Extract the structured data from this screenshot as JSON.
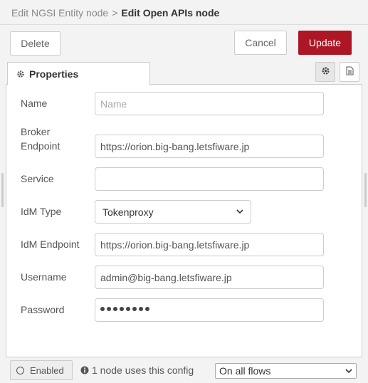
{
  "header": {
    "prev_crumb": "Edit NGSI Entity node",
    "separator": ">",
    "current_crumb": "Edit Open APIs node"
  },
  "toolbar": {
    "delete_label": "Delete",
    "cancel_label": "Cancel",
    "update_label": "Update"
  },
  "tabs": {
    "properties_label": "Properties",
    "settings_icon": "gear-icon",
    "info_icon": "document-icon"
  },
  "form": {
    "name": {
      "label": "Name",
      "value": "",
      "placeholder": "Name"
    },
    "broker_endpoint": {
      "label_line1": "Broker",
      "label_line2": "Endpoint",
      "value": "https://orion.big-bang.letsfiware.jp"
    },
    "service": {
      "label": "Service",
      "value": ""
    },
    "idm_type": {
      "label": "IdM Type",
      "value": "Tokenproxy"
    },
    "idm_endpoint": {
      "label": "IdM Endpoint",
      "value": "https://orion.big-bang.letsfiware.jp"
    },
    "username": {
      "label": "Username",
      "value": "admin@big-bang.letsfiware.jp"
    },
    "password": {
      "label": "Password",
      "masked_length": 8
    }
  },
  "footer": {
    "enabled_label": "Enabled",
    "usage_text": "1 node uses this config",
    "scope_value": "On all flows"
  },
  "colors": {
    "update_button": "#ad1625",
    "background": "#f3f3f3"
  }
}
